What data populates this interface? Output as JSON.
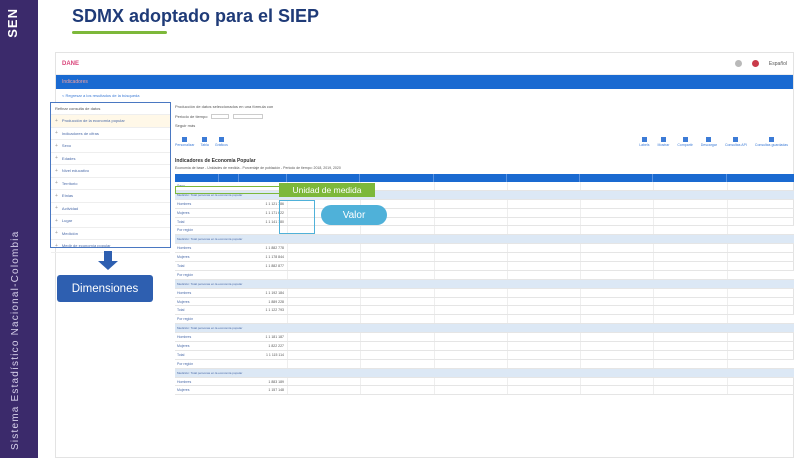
{
  "brand": {
    "logo": "SEN",
    "vertical_text": "Sistema Estadístico Nacional-Colombia"
  },
  "slide": {
    "title": "SDMX adoptado para el SIEP"
  },
  "app": {
    "logo": "DANE",
    "band_text": "Indicadores",
    "breadcrumb": "< Regresar a los resultados de la búsqueda",
    "user": "Español"
  },
  "dimensions": {
    "title": "Refinar consulta de datos",
    "items": [
      "Producción de la economía popular",
      "Indicadores de cifras",
      "Sexo",
      "Edades",
      "Nivel educativo",
      "Territorio",
      "Etnias",
      "Actividad",
      "Lugar",
      "Medición",
      "Medir de economía popular"
    ]
  },
  "query": {
    "title": "Producción de datos seleccionados en una fórmula con",
    "filter_label": "Periodo de tiempo",
    "sub_label": "Seguir más"
  },
  "toolbar": {
    "left": [
      "Personalizar",
      "Tabla",
      "Gráficos"
    ],
    "right": [
      "Labels",
      "Mostrar",
      "Compartir",
      "Descargar",
      "Consultas API",
      "Consultas guardadas"
    ]
  },
  "report": {
    "title": "Indicadores de Economía Popular",
    "subtitle": "Economía de base - Unidades de medida - Porcentaje de población - Periodo de tiempo: 2018, 2019, 2020"
  },
  "table": {
    "section_text": "Medición: Total personas en la economía popular",
    "rows": [
      {
        "type": "label",
        "label": "Sexo"
      },
      {
        "type": "section"
      },
      {
        "type": "data",
        "label": "Hombres",
        "value": "1 1 121 786"
      },
      {
        "type": "data",
        "label": "Mujeres",
        "value": "1 1 171 622"
      },
      {
        "type": "data",
        "label": "Total",
        "value": "1 1 141 180"
      },
      {
        "type": "total",
        "label": "Por región"
      },
      {
        "type": "section"
      },
      {
        "type": "data",
        "label": "Hombres",
        "value": "1 1 882 778"
      },
      {
        "type": "data",
        "label": "Mujeres",
        "value": "1 1 178 844"
      },
      {
        "type": "data",
        "label": "Total",
        "value": "1 1 882 877"
      },
      {
        "type": "total",
        "label": "Por región"
      },
      {
        "type": "section"
      },
      {
        "type": "data",
        "label": "Hombres",
        "value": "1 1 192 184"
      },
      {
        "type": "data",
        "label": "Mujeres",
        "value": "1 889 228"
      },
      {
        "type": "data",
        "label": "Total",
        "value": "1 1 122 793"
      },
      {
        "type": "total",
        "label": "Por región"
      },
      {
        "type": "section"
      },
      {
        "type": "data",
        "label": "Hombres",
        "value": "1 1 181 187"
      },
      {
        "type": "data",
        "label": "Mujeres",
        "value": "1 822 227"
      },
      {
        "type": "data",
        "label": "Total",
        "value": "1 1 115 114"
      },
      {
        "type": "total",
        "label": "Por región"
      },
      {
        "type": "section"
      },
      {
        "type": "data",
        "label": "Hombres",
        "value": "1 883 189"
      },
      {
        "type": "data",
        "label": "Mujeres",
        "value": "1 157 148"
      }
    ]
  },
  "callouts": {
    "dimensions_label": "Dimensiones",
    "unit_label": "Unidad de medida",
    "value_label": "Valor"
  },
  "colors": {
    "brand_bar": "#3b2a6b",
    "title": "#1f3b78",
    "accent_green": "#7db83a",
    "accent_blue": "#2e5fb0",
    "callout_cyan": "#4fb1d9",
    "app_band": "#1a6ad1"
  }
}
